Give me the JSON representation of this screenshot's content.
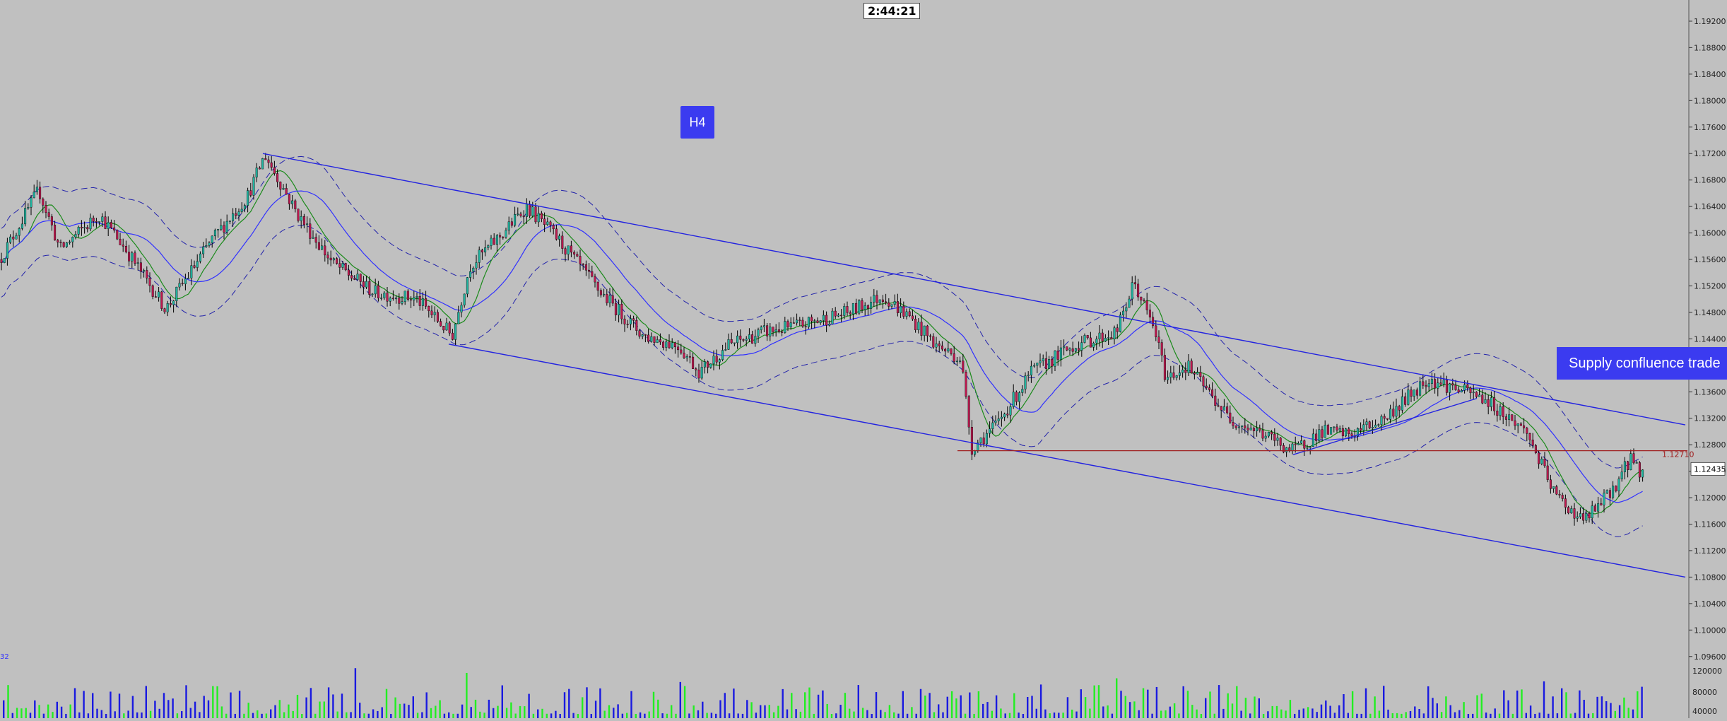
{
  "timer": "2:44:21",
  "timeframe": "H4",
  "annotation": "Supply confluence trade",
  "volume_indicator_label": "32",
  "colors": {
    "background": "#c0c0c0",
    "channel": "#2323e0",
    "bull_candle": "#1fb5a0",
    "bear_candle": "#c01850",
    "ma_fast": "#1a8a1a",
    "ma_slow": "#3030ff",
    "level_line": "#a02020",
    "vol_green": "#22ee22",
    "vol_blue": "#1a1ae0"
  },
  "chart_data": {
    "type": "candlestick",
    "instrument_timeframe": "H4",
    "y_axis": {
      "ylim": [
        1.0948,
        1.1952
      ],
      "ticks": [
        "1.19200",
        "1.18800",
        "1.18400",
        "1.18000",
        "1.17600",
        "1.17200",
        "1.16800",
        "1.16400",
        "1.16000",
        "1.15600",
        "1.15200",
        "1.14800",
        "1.14400",
        "1.14000",
        "1.13600",
        "1.13200",
        "1.12800",
        "1.12400",
        "1.12000",
        "1.11600",
        "1.11200",
        "1.10800",
        "1.10400",
        "1.10000",
        "1.09600"
      ]
    },
    "current_price": "1.12435",
    "horizontal_level": {
      "value": 1.1271,
      "label": "1.12710"
    },
    "price_path_anchors": [
      [
        0,
        1.156
      ],
      [
        55,
        1.1665
      ],
      [
        85,
        1.1575
      ],
      [
        140,
        1.1628
      ],
      [
        175,
        1.158
      ],
      [
        235,
        1.1485
      ],
      [
        300,
        1.159
      ],
      [
        350,
        1.1655
      ],
      [
        375,
        1.1718
      ],
      [
        420,
        1.163
      ],
      [
        470,
        1.1555
      ],
      [
        530,
        1.151
      ],
      [
        590,
        1.15
      ],
      [
        640,
        1.1445
      ],
      [
        665,
        1.155
      ],
      [
        710,
        1.1598
      ],
      [
        745,
        1.164
      ],
      [
        790,
        1.159
      ],
      [
        850,
        1.151
      ],
      [
        910,
        1.1445
      ],
      [
        960,
        1.143
      ],
      [
        990,
        1.139
      ],
      [
        1030,
        1.143
      ],
      [
        1080,
        1.145
      ],
      [
        1130,
        1.146
      ],
      [
        1200,
        1.148
      ],
      [
        1250,
        1.1505
      ],
      [
        1290,
        1.147
      ],
      [
        1325,
        1.143
      ],
      [
        1360,
        1.141
      ],
      [
        1375,
        1.1275
      ],
      [
        1410,
        1.131
      ],
      [
        1460,
        1.139
      ],
      [
        1520,
        1.143
      ],
      [
        1580,
        1.145
      ],
      [
        1605,
        1.1525
      ],
      [
        1635,
        1.145
      ],
      [
        1650,
        1.138
      ],
      [
        1680,
        1.14
      ],
      [
        1740,
        1.132
      ],
      [
        1790,
        1.1295
      ],
      [
        1830,
        1.127
      ],
      [
        1870,
        1.13
      ],
      [
        1910,
        1.1295
      ],
      [
        1960,
        1.132
      ],
      [
        2020,
        1.138
      ],
      [
        2060,
        1.1365
      ],
      [
        2100,
        1.135
      ],
      [
        2130,
        1.1325
      ],
      [
        2160,
        1.13
      ],
      [
        2200,
        1.1205
      ],
      [
        2240,
        1.1165
      ],
      [
        2265,
        1.119
      ],
      [
        2290,
        1.1225
      ],
      [
        2310,
        1.1265
      ],
      [
        2318,
        1.124
      ],
      [
        2330,
        1.1243
      ]
    ],
    "volume_axis": {
      "ticks": [
        "120000",
        "80000",
        "40000"
      ]
    },
    "lines": [
      {
        "name": "channel-upper",
        "from": [
          372,
          1.172
        ],
        "to": [
          2385,
          1.131
        ]
      },
      {
        "name": "channel-lower",
        "from": [
          635,
          1.1432
        ],
        "to": [
          2385,
          1.108
        ]
      },
      {
        "name": "trend-support",
        "from": [
          1830,
          1.1265
        ],
        "to": [
          2090,
          1.135
        ]
      }
    ]
  }
}
